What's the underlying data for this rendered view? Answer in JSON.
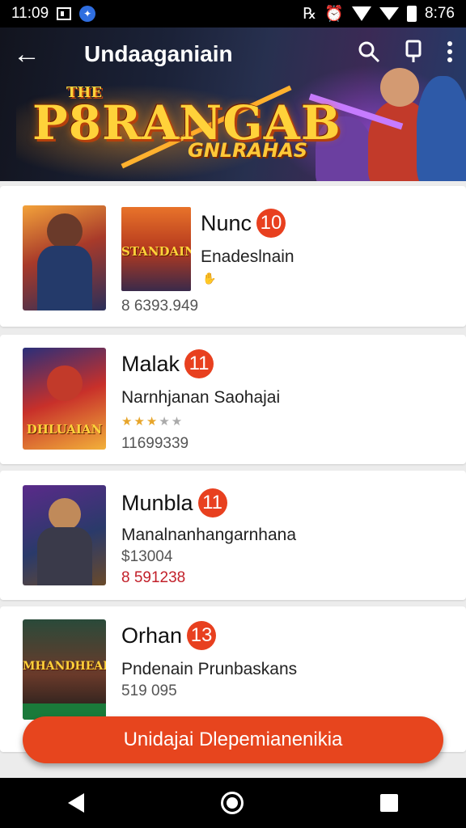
{
  "status_bar": {
    "time": "11:09",
    "clock_right": "8:76"
  },
  "app_bar": {
    "title": "Undaaganiain"
  },
  "banner": {
    "logo_the": "THE",
    "logo_main": "P8RANGAB",
    "logo_sub": "GNLRAHAS"
  },
  "items": [
    {
      "name": "Nunc",
      "badge": "10",
      "subtitle": "Enadeslnain",
      "meta": "8 6393.949",
      "thumb_text": "STANDAIN",
      "has_stars": false
    },
    {
      "name": "Malak",
      "badge": "11",
      "subtitle": "Narnhjanan Saohajai",
      "meta": "11699339",
      "thumb_text": "DHLUAIAN",
      "has_stars": true,
      "rating": 3
    },
    {
      "name": "Munbla",
      "badge": "11",
      "subtitle": "Manalnanhangarnhana",
      "meta": "$13004",
      "meta2": "8 591238",
      "has_stars": false
    },
    {
      "name": "Orhan",
      "badge": "13",
      "subtitle": "Pndenain Prunbaskans",
      "meta": "519 095",
      "thumb_text": "MHANDHEAI",
      "has_stars": false
    }
  ],
  "cta": {
    "label": "Unidajai Dlepemianenikia"
  },
  "colors": {
    "accent": "#e7451e",
    "badge": "#e8401f"
  }
}
